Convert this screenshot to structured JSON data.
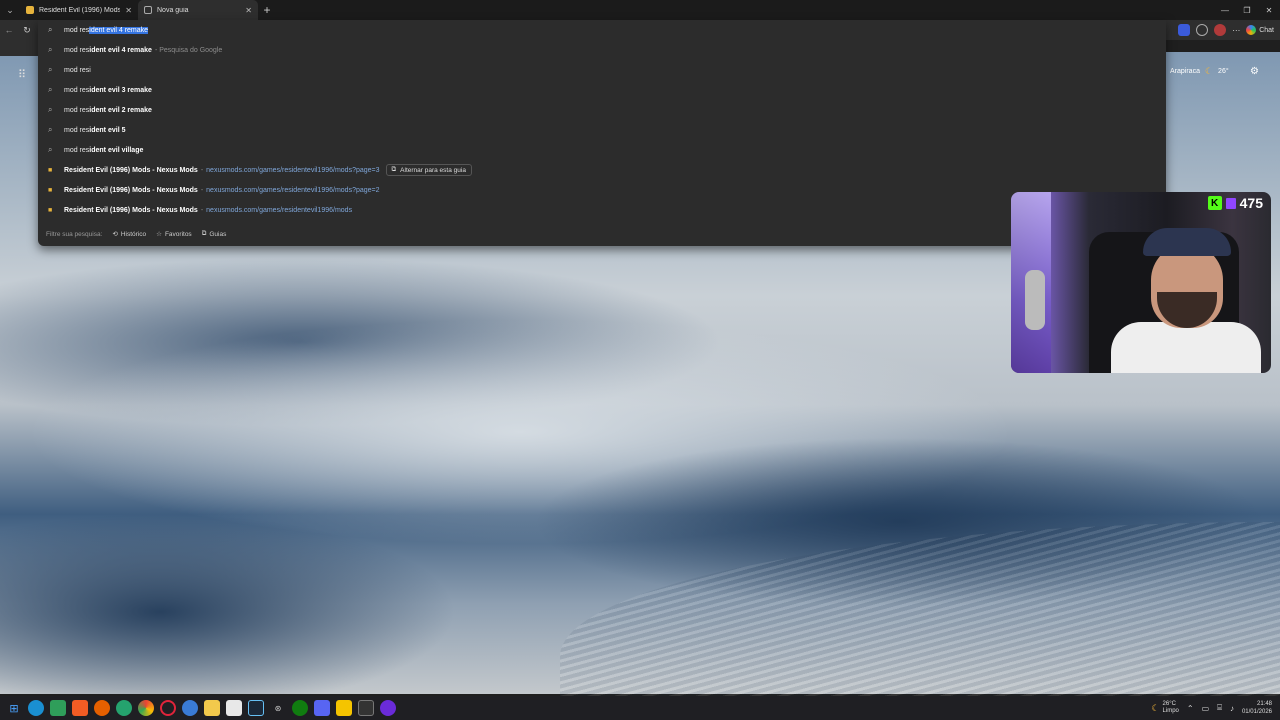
{
  "tabs": [
    {
      "title": "Resident Evil (1996) Mods - Nexus Mods",
      "active": false
    },
    {
      "title": "Nova guia",
      "active": true
    }
  ],
  "omnibox": {
    "typed": "mod res",
    "autocomplete": "ident evil 4 remake"
  },
  "suggestions": [
    {
      "kind": "search",
      "prefix": "mod res",
      "bold": "ident evil 4 remake",
      "suffix": "- Pesquisa do Google"
    },
    {
      "kind": "search",
      "prefix": "mod resi",
      "bold": "",
      "suffix": ""
    },
    {
      "kind": "search",
      "prefix": "mod res",
      "bold": "ident evil 3 remake",
      "suffix": ""
    },
    {
      "kind": "search",
      "prefix": "mod res",
      "bold": "ident evil 2 remake",
      "suffix": ""
    },
    {
      "kind": "search",
      "prefix": "mod res",
      "bold": "ident evil 5",
      "suffix": ""
    },
    {
      "kind": "search",
      "prefix": "mod res",
      "bold": "ident evil village",
      "suffix": ""
    }
  ],
  "history_results": [
    {
      "title": "Resident Evil (1996) Mods - Nexus Mods",
      "url": "nexusmods.com/games/residentevil1996/mods?page=3",
      "switch_label": "Alternar para esta guia"
    },
    {
      "title": "Resident Evil (1996) Mods - Nexus Mods",
      "url": "nexusmods.com/games/residentevil1996/mods?page=2",
      "switch_label": ""
    },
    {
      "title": "Resident Evil (1996) Mods - Nexus Mods",
      "url": "nexusmods.com/games/residentevil1996/mods",
      "switch_label": ""
    }
  ],
  "filter": {
    "placeholder": "Filtre sua pesquisa:",
    "chips": [
      "Histórico",
      "Favoritos",
      "Guias"
    ]
  },
  "toolbar": {
    "chat_label": "Chat"
  },
  "weather": {
    "city": "Arapiraca",
    "temp": "26°"
  },
  "stream": {
    "viewers": "475"
  },
  "taskbar": {
    "weather_temp": "26°C",
    "weather_desc": "Limpo",
    "time": "21:48",
    "date": "01/01/2026"
  }
}
